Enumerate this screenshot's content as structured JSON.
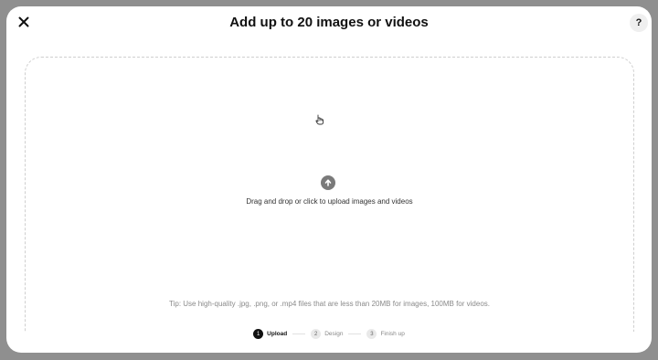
{
  "modal": {
    "title": "Add up to 20 images or videos",
    "close_icon": "close-icon",
    "help_label": "?"
  },
  "dropzone": {
    "instruction": "Drag and drop or click to upload images and videos",
    "upload_icon": "upload-arrow-icon",
    "tip": "Tip: Use high-quality .jpg, .png, or .mp4 files that are less than 20MB for images, 100MB for videos."
  },
  "stepper": {
    "steps": [
      {
        "number": "1",
        "label": "Upload",
        "active": true
      },
      {
        "number": "2",
        "label": "Design",
        "active": false
      },
      {
        "number": "3",
        "label": "Finish up",
        "active": false
      }
    ]
  },
  "colors": {
    "backdrop": "#8f8f8f",
    "active_step": "#111111",
    "upload_icon_bg": "#7a7a7a"
  }
}
